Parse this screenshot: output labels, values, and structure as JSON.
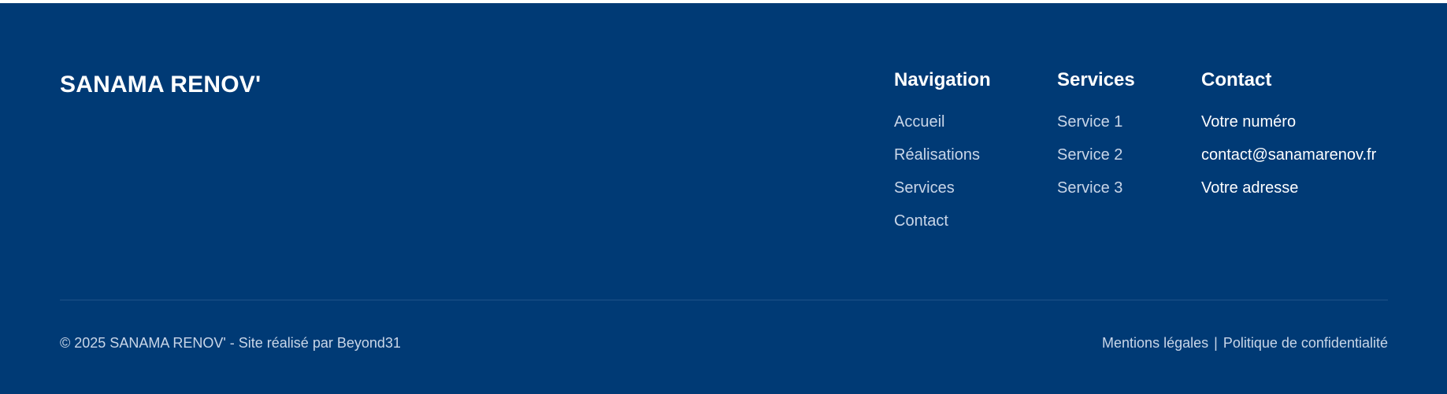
{
  "footer": {
    "brand": "SANAMA RENOV'",
    "columns": {
      "navigation": {
        "title": "Navigation",
        "links": [
          "Accueil",
          "Réalisations",
          "Services",
          "Contact"
        ]
      },
      "services": {
        "title": "Services",
        "links": [
          "Service 1",
          "Service 2",
          "Service 3"
        ]
      },
      "contact": {
        "title": "Contact",
        "items": [
          "Votre numéro",
          "contact@sanamarenov.fr",
          "Votre adresse"
        ]
      }
    },
    "copyright": "© 2025 SANAMA RENOV' - Site réalisé par Beyond31",
    "legal": {
      "mentions": "Mentions légales",
      "separator": "|",
      "privacy": "Politique de confidentialité"
    }
  },
  "colors": {
    "background": "#003a75",
    "text_primary": "#ffffff",
    "text_muted": "#c9d6e8",
    "divider": "#1f5289"
  }
}
